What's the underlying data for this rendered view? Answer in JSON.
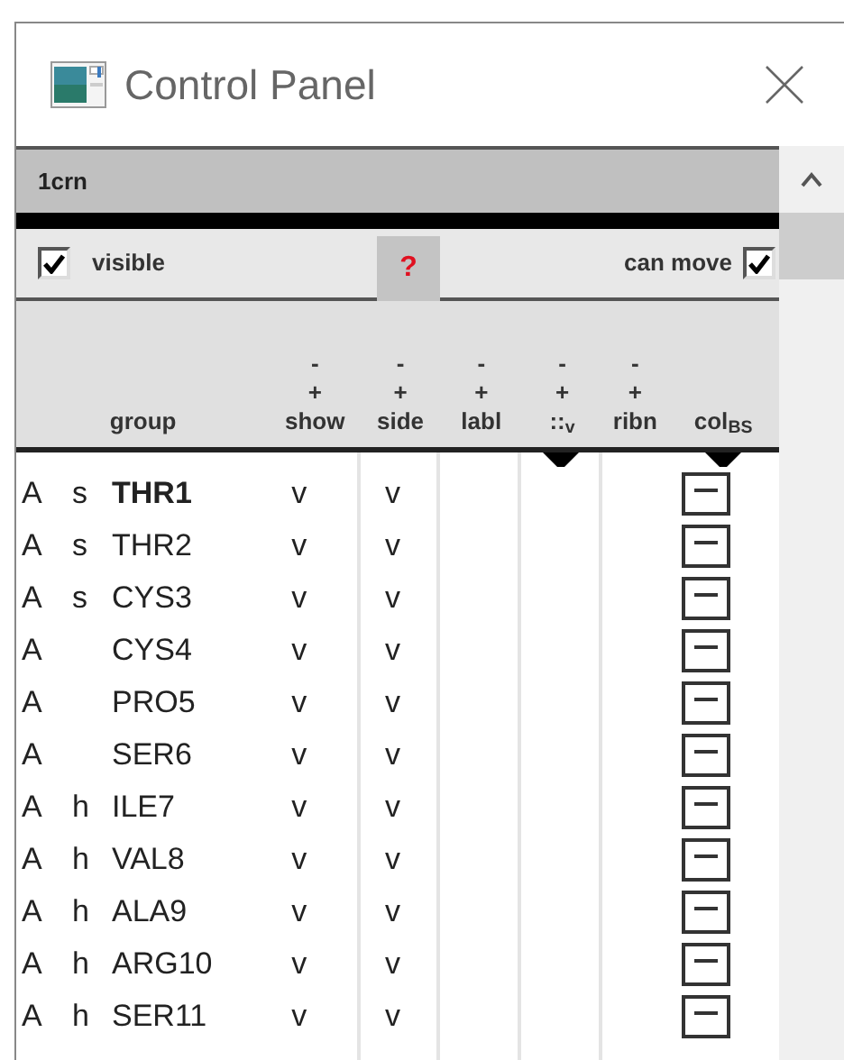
{
  "window": {
    "title": "Control Panel"
  },
  "molecule": {
    "name": "1crn"
  },
  "options": {
    "visible": {
      "label": "visible",
      "checked": true
    },
    "help": "?",
    "can_move": {
      "label": "can move",
      "checked": true
    }
  },
  "columns": [
    {
      "label": "group"
    },
    {
      "label": "show",
      "minus": "-",
      "plus": "+"
    },
    {
      "label": "side",
      "minus": "-",
      "plus": "+"
    },
    {
      "label": "labl",
      "minus": "-",
      "plus": "+"
    },
    {
      "label": "::$_{v}$",
      "minus": "-",
      "plus": "+",
      "marker": true
    },
    {
      "label": "ribn",
      "minus": "-",
      "plus": "+"
    },
    {
      "label": "col$_{BS}$",
      "marker": true
    }
  ],
  "rows": [
    {
      "chain": "A",
      "ss": "s",
      "name": "THR1",
      "selected": true,
      "show": "v",
      "side": "v"
    },
    {
      "chain": "A",
      "ss": "s",
      "name": "THR2",
      "selected": false,
      "show": "v",
      "side": "v"
    },
    {
      "chain": "A",
      "ss": "s",
      "name": "CYS3",
      "selected": false,
      "show": "v",
      "side": "v"
    },
    {
      "chain": "A",
      "name": "CYS4",
      "selected": false,
      "show": "v",
      "side": "v"
    },
    {
      "chain": "A",
      "name": "PRO5",
      "selected": false,
      "show": "v",
      "side": "v"
    },
    {
      "chain": "A",
      "name": "SER6",
      "selected": false,
      "show": "v",
      "side": "v"
    },
    {
      "chain": "A",
      "ss": "h",
      "name": "ILE7",
      "selected": false,
      "show": "v",
      "side": "v"
    },
    {
      "chain": "A",
      "ss": "h",
      "name": "VAL8",
      "selected": false,
      "show": "v",
      "side": "v"
    },
    {
      "chain": "A",
      "ss": "h",
      "name": "ALA9",
      "selected": false,
      "show": "v",
      "side": "v"
    },
    {
      "chain": "A",
      "ss": "h",
      "name": "ARG10",
      "selected": false,
      "show": "v",
      "side": "v"
    },
    {
      "chain": "A",
      "ss": "h",
      "name": "SER11",
      "selected": false,
      "show": "v",
      "side": "v"
    }
  ]
}
